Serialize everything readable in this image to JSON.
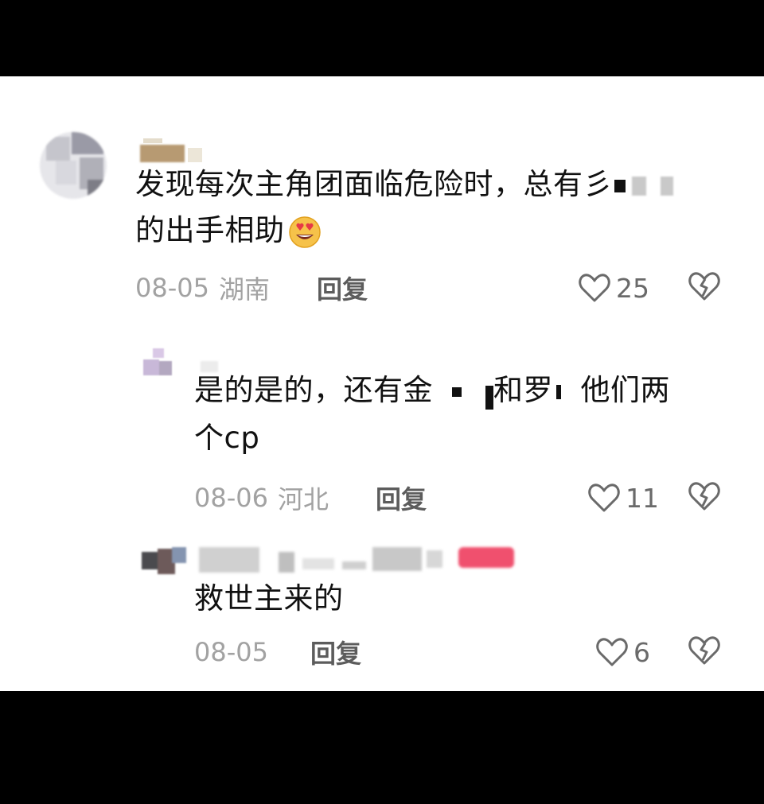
{
  "comments": [
    {
      "text_line1": "发现每次主角团面临危险时，总有彡",
      "text_line2": "的出手相助",
      "emoji": "heart-eyes-emoji",
      "date": "08-05",
      "location": "湖南",
      "reply_label": "回复",
      "likes": "25"
    },
    {
      "text_part1": "是的是的，还有金",
      "text_part2": "和罗",
      "text_part3": "他们两",
      "text_line2": "个cp",
      "date": "08-06",
      "location": "河北",
      "reply_label": "回复",
      "likes": "11"
    },
    {
      "text_line1": "救世主来的",
      "date": "08-05",
      "reply_label": "回复",
      "likes": "6"
    }
  ],
  "colors": {
    "background": "#ffffff",
    "frame": "#000000",
    "meta_gray": "#a2a2a2",
    "reply_gray": "#5c5c5c",
    "icon_gray": "#6a6a6a",
    "badge_pink": "#f0506e"
  }
}
